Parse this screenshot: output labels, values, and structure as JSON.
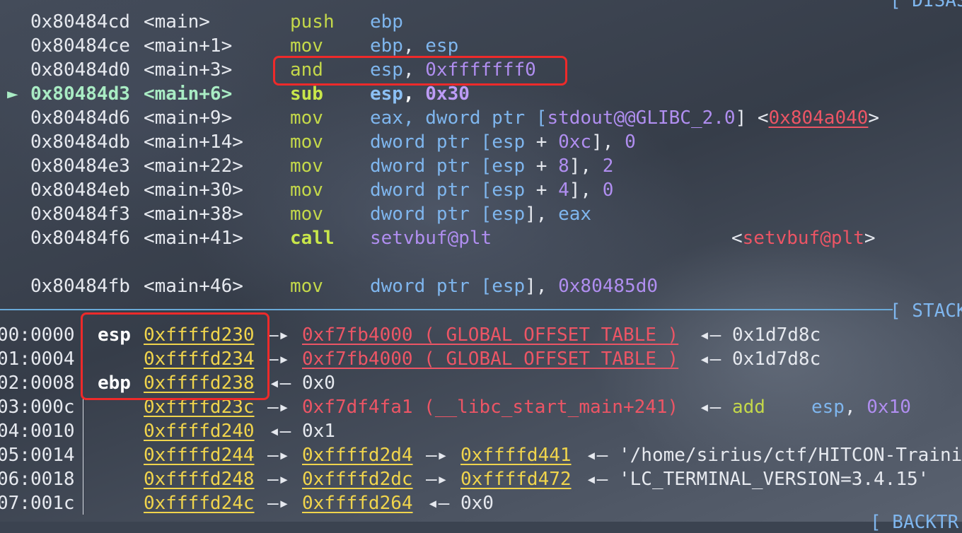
{
  "headers": {
    "disasm": "[ DISAS",
    "stack": "[ STACK",
    "backtrace": "[ BACKTR"
  },
  "disasm": [
    {
      "addr": "0x80484cd",
      "sym": "<main>",
      "op": "push",
      "a": "ebp"
    },
    {
      "addr": "0x80484ce",
      "sym": "<main+1>",
      "op": "mov",
      "a": "ebp",
      "b": ", ",
      "c": "esp"
    },
    {
      "addr": "0x80484d0",
      "sym": "<main+3>",
      "op": "and",
      "a": "esp",
      "b": ", ",
      "c": "0xfffffff0"
    },
    {
      "marker": "►",
      "addr": "0x80484d3",
      "sym": "<main+6>",
      "op": "sub",
      "a": "esp",
      "b": ", ",
      "c": "0x30"
    },
    {
      "addr": "0x80484d6",
      "sym": "<main+9>",
      "op": "mov",
      "a": "eax, dword ptr [",
      "b": "stdout@@GLIBC_2.0",
      "c": "] <",
      "d": "0x804a040",
      "e": ">"
    },
    {
      "addr": "0x80484db",
      "sym": "<main+14>",
      "op": "mov",
      "a": "dword ptr [",
      "b": "esp",
      "c": " + ",
      "d": "0xc",
      "e": "], ",
      "f": "0"
    },
    {
      "addr": "0x80484e3",
      "sym": "<main+22>",
      "op": "mov",
      "a": "dword ptr [",
      "b": "esp",
      "c": " + ",
      "d": "8",
      "e": "], ",
      "f": "2"
    },
    {
      "addr": "0x80484eb",
      "sym": "<main+30>",
      "op": "mov",
      "a": "dword ptr [",
      "b": "esp",
      "c": " + ",
      "d": "4",
      "e": "], ",
      "f": "0"
    },
    {
      "addr": "0x80484f3",
      "sym": "<main+38>",
      "op": "mov",
      "a": "dword ptr [",
      "b": "esp",
      "c": "], ",
      "d": "eax"
    },
    {
      "addr": "0x80484f6",
      "sym": "<main+41>",
      "op": "call",
      "a": "setvbuf@plt",
      "b": "<",
      "c": "setvbuf@plt",
      "d": ">"
    },
    {
      "addr": "0x80484fb",
      "sym": "<main+46>",
      "op": "mov",
      "a": "dword ptr [",
      "b": "esp",
      "c": "], ",
      "d": "0x80485d0"
    }
  ],
  "stack": [
    {
      "idx": "00:0000",
      "reg": "esp",
      "addr": "0xffffd230",
      "arrow": "—▸",
      "val": "0xf7fb4000 (_GLOBAL_OFFSET_TABLE_)",
      "back": "◂—",
      "tail": "0x1d7d8c"
    },
    {
      "idx": "01:0004",
      "reg": "",
      "addr": "0xffffd234",
      "arrow": "—▸",
      "val": "0xf7fb4000 (_GLOBAL_OFFSET_TABLE_)",
      "back": "◂—",
      "tail": "0x1d7d8c"
    },
    {
      "idx": "02:0008",
      "reg": "ebp",
      "addr": "0xffffd238",
      "back": "◂—",
      "tail": "0x0"
    },
    {
      "idx": "03:000c",
      "reg": "",
      "addr": "0xffffd23c",
      "arrow": "—▸",
      "val": "0xf7df4fa1 (__libc_start_main+241)",
      "back": "◂—",
      "ins": "add",
      "ins_a": "esp",
      "ins_b": ", ",
      "ins_c": "0x10"
    },
    {
      "idx": "04:0010",
      "reg": "",
      "addr": "0xffffd240",
      "back": "◂—",
      "tail": "0x1"
    },
    {
      "idx": "05:0014",
      "reg": "",
      "addr": "0xffffd244",
      "arrow": "—▸",
      "p1": "0xffffd2d4",
      "arrow2": "—▸",
      "p2": "0xffffd441",
      "back": "◂—",
      "str": "'/home/sirius/ctf/HITCON-Trainin"
    },
    {
      "idx": "06:0018",
      "reg": "",
      "addr": "0xffffd248",
      "arrow": "—▸",
      "p1": "0xffffd2dc",
      "arrow2": "—▸",
      "p2": "0xffffd472",
      "back": "◂—",
      "str": "'LC_TERMINAL_VERSION=3.4.15'"
    },
    {
      "idx": "07:001c",
      "reg": "",
      "addr": "0xffffd24c",
      "arrow": "—▸",
      "p1": "0xffffd264",
      "back": "◂—",
      "tail": "0x0"
    }
  ]
}
